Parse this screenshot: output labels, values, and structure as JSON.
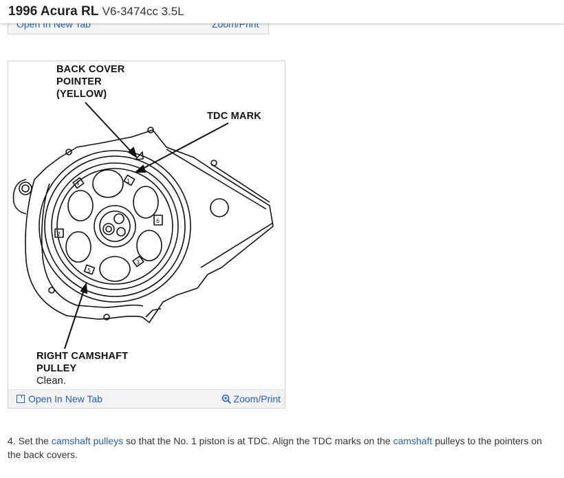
{
  "header": {
    "make_model": "1996 Acura RL",
    "engine": "V6-3474cc 3.5L"
  },
  "previous_card": {
    "open_label": "Open In New Tab",
    "zoom_label": "Zoom/Print"
  },
  "figure": {
    "labels": {
      "back_cover_pointer": "BACK COVER\nPOINTER\n(YELLOW)",
      "tdc_mark": "TDC MARK",
      "right_camshaft_pulley": "RIGHT CAMSHAFT\nPULLEY",
      "clean_note": "Clean."
    },
    "pulley_numbers": [
      "1",
      "4",
      "2",
      "5",
      "3",
      "6"
    ],
    "footer": {
      "open_label": "Open In New Tab",
      "zoom_label": "Zoom/Print",
      "open_icon": "new-tab-icon",
      "zoom_icon": "magnifier-icon"
    }
  },
  "instruction": {
    "step": "4. Set the ",
    "link1": "camshaft pulleys",
    "mid1": " so that the No. 1 piston is at TDC. Align the TDC marks on the ",
    "link2": "camshaft",
    "mid2": " pulleys to the pointers on the back covers."
  },
  "colors": {
    "link": "#2a5db0",
    "footer_bg": "#f1f2f4",
    "text": "#333333"
  }
}
